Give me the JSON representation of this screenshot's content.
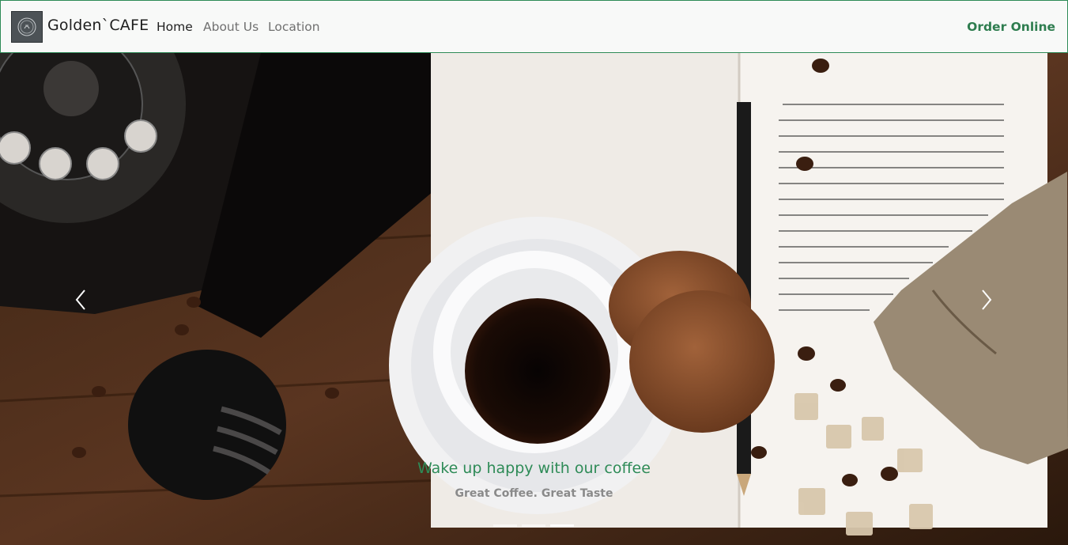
{
  "brand": {
    "name": "Golden`CAFE",
    "logo_icon": "cafe-seal-icon"
  },
  "nav": {
    "home": "Home",
    "about": "About Us",
    "location": "Location",
    "cta": "Order Online"
  },
  "hero": {
    "caption_title": "Wake up happy with our coffee",
    "caption_subtitle": "Great Coffee. Great Taste",
    "prev_icon": "chevron-left-icon",
    "next_icon": "chevron-right-icon",
    "slide_count": 3,
    "active_slide": 3
  },
  "colors": {
    "accent": "#2e8b57",
    "nav_background": "#f8f9f8",
    "nav_text": "#707070"
  }
}
